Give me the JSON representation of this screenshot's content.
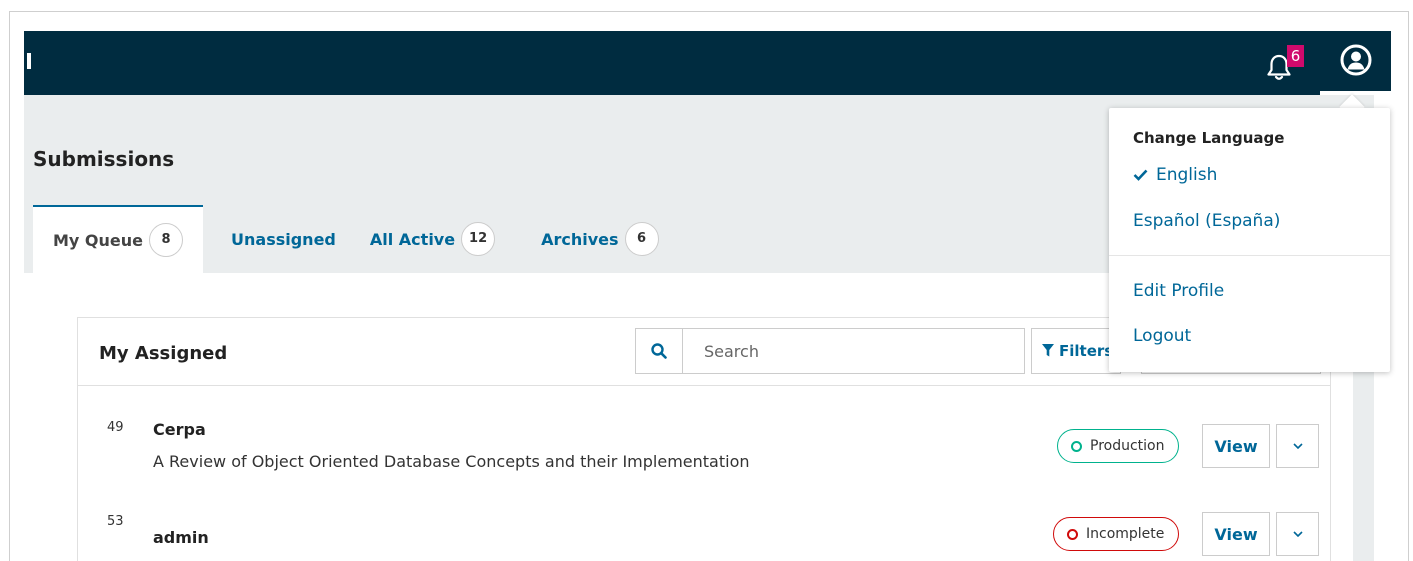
{
  "header": {
    "notification_count": "6"
  },
  "page": {
    "title": "Submissions"
  },
  "tabs": [
    {
      "label": "My Queue",
      "count": "8"
    },
    {
      "label": "Unassigned"
    },
    {
      "label": "All Active",
      "count": "12"
    },
    {
      "label": "Archives",
      "count": "6"
    }
  ],
  "panel": {
    "title": "My Assigned",
    "search_placeholder": "Search",
    "filter_label": "Filters"
  },
  "submissions": [
    {
      "id": "49",
      "author": "Cerpa",
      "title": "A Review of Object Oriented Database Concepts and their Implementation",
      "stage": "Production",
      "view_label": "View"
    },
    {
      "id": "53",
      "author": "admin",
      "title": "",
      "stage": "Incomplete",
      "view_label": "View"
    }
  ],
  "user_menu": {
    "language_heading": "Change Language",
    "languages": [
      "English",
      "Español (España)"
    ],
    "selected_language": "English",
    "edit_profile": "Edit Profile",
    "logout": "Logout"
  },
  "colors": {
    "header_bg": "#002c40",
    "link": "#006798",
    "badge": "#d00a6c",
    "production": "#00b28d",
    "incomplete": "#d00a0a"
  },
  "icons": {
    "notifications": "bell-icon",
    "user": "user-circle-icon",
    "search": "search-icon",
    "filter": "filter-icon",
    "check": "check-icon",
    "expand": "chevron-down-icon"
  }
}
